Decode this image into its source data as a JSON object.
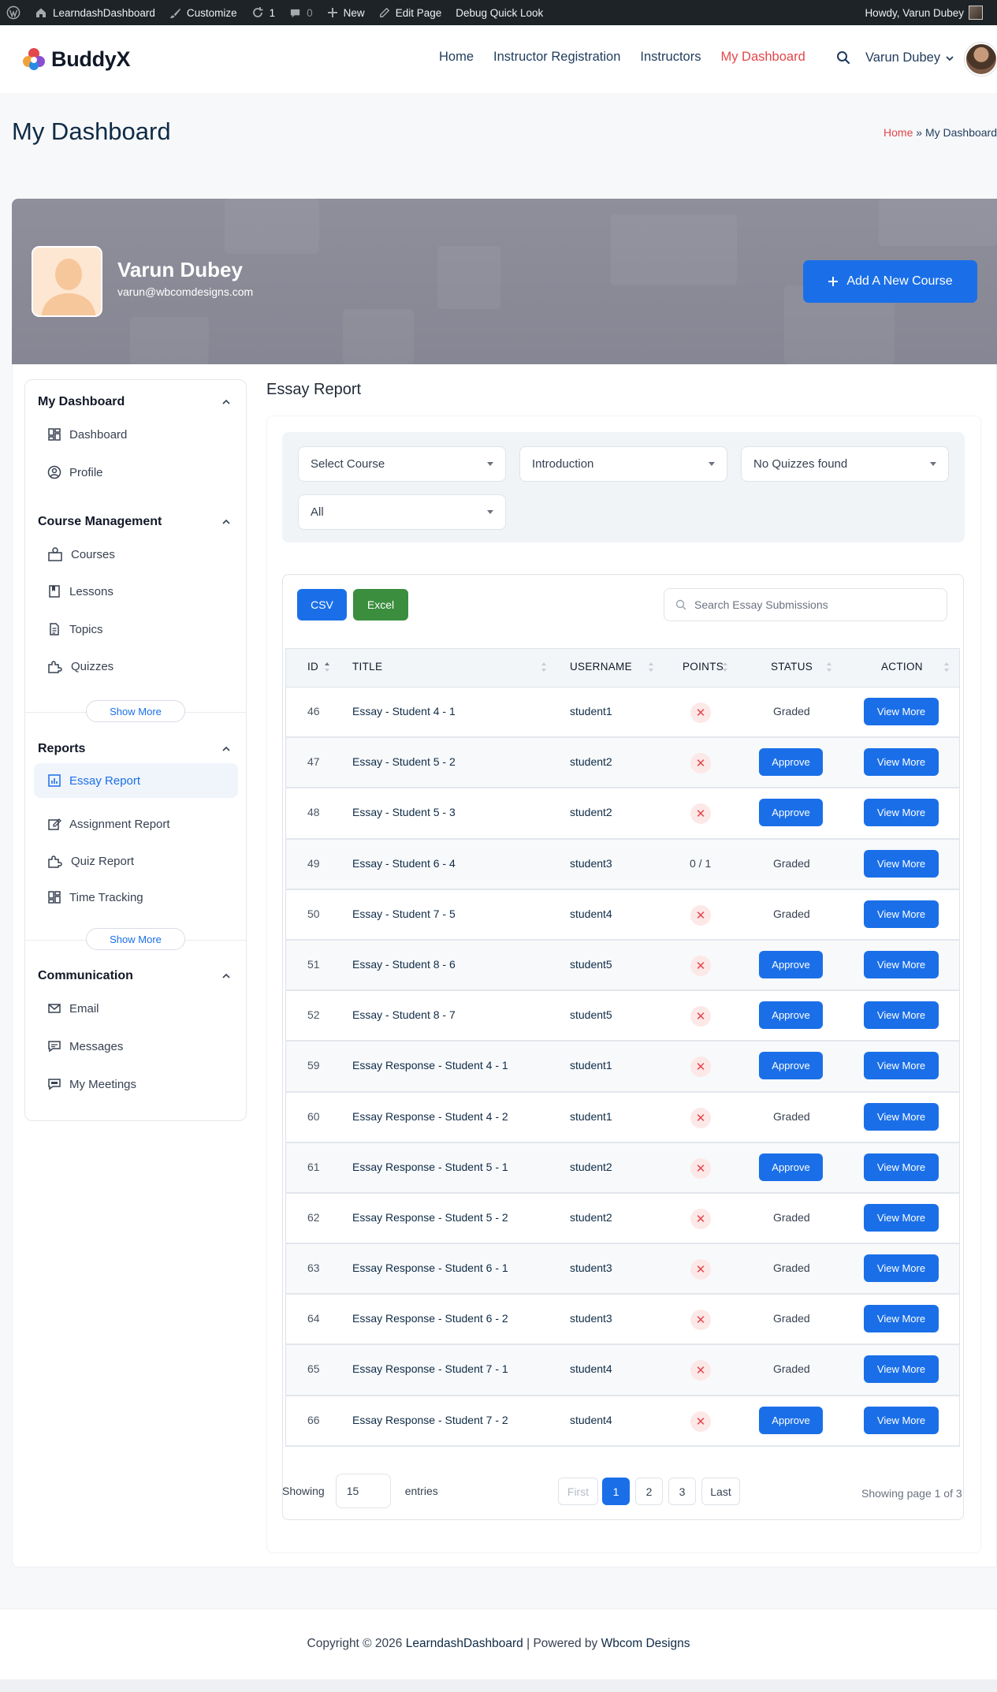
{
  "admin_bar": {
    "site_name": "LearndashDashboard",
    "customize": "Customize",
    "updates": "1",
    "comments": "0",
    "new": "New",
    "edit_page": "Edit Page",
    "debug": "Debug Quick Look",
    "howdy": "Howdy, Varun Dubey"
  },
  "header": {
    "logo": "BuddyX",
    "nav": [
      "Home",
      "Instructor Registration",
      "Instructors",
      "My Dashboard"
    ],
    "active_nav": "My Dashboard",
    "user": "Varun Dubey"
  },
  "page": {
    "title": "My Dashboard",
    "breadcrumb_home": "Home",
    "breadcrumb_sep": "»",
    "breadcrumb_current": "My Dashboard"
  },
  "profile": {
    "name": "Varun Dubey",
    "email": "varun@wbcomdesigns.com",
    "add_course": "Add A New Course"
  },
  "sidebar": {
    "sections": [
      {
        "title": "My Dashboard",
        "items": [
          "Dashboard",
          "Profile"
        ]
      },
      {
        "title": "Course Management",
        "items": [
          "Courses",
          "Lessons",
          "Topics",
          "Quizzes"
        ],
        "more": "Show More"
      },
      {
        "title": "Reports",
        "items": [
          "Essay Report",
          "Assignment Report",
          "Quiz Report",
          "Time Tracking"
        ],
        "more": "Show More",
        "active": "Essay Report"
      },
      {
        "title": "Communication",
        "items": [
          "Email",
          "Messages",
          "My Meetings"
        ]
      }
    ]
  },
  "report": {
    "title": "Essay Report",
    "filters": [
      "Select Course",
      "Introduction",
      "No Quizzes found",
      "All"
    ],
    "csv": "CSV",
    "excel": "Excel",
    "search_placeholder": "Search Essay Submissions",
    "columns": [
      "ID",
      "TITLE",
      "USERNAME",
      "POINTS",
      "STATUS",
      "ACTION"
    ],
    "rows": [
      {
        "id": "46",
        "title": "Essay - Student 4 - 1",
        "user": "student1",
        "points": "x",
        "status": "Graded"
      },
      {
        "id": "47",
        "title": "Essay - Student 5 - 2",
        "user": "student2",
        "points": "x",
        "status": "Approve"
      },
      {
        "id": "48",
        "title": "Essay - Student 5 - 3",
        "user": "student2",
        "points": "x",
        "status": "Approve"
      },
      {
        "id": "49",
        "title": "Essay - Student 6 - 4",
        "user": "student3",
        "points": "0 / 1",
        "status": "Graded"
      },
      {
        "id": "50",
        "title": "Essay - Student 7 - 5",
        "user": "student4",
        "points": "x",
        "status": "Graded"
      },
      {
        "id": "51",
        "title": "Essay - Student 8 - 6",
        "user": "student5",
        "points": "x",
        "status": "Approve"
      },
      {
        "id": "52",
        "title": "Essay - Student 8 - 7",
        "user": "student5",
        "points": "x",
        "status": "Approve"
      },
      {
        "id": "59",
        "title": "Essay Response - Student 4 - 1",
        "user": "student1",
        "points": "x",
        "status": "Approve"
      },
      {
        "id": "60",
        "title": "Essay Response - Student 4 - 2",
        "user": "student1",
        "points": "x",
        "status": "Graded"
      },
      {
        "id": "61",
        "title": "Essay Response - Student 5 - 1",
        "user": "student2",
        "points": "x",
        "status": "Approve"
      },
      {
        "id": "62",
        "title": "Essay Response - Student 5 - 2",
        "user": "student2",
        "points": "x",
        "status": "Graded"
      },
      {
        "id": "63",
        "title": "Essay Response - Student 6 - 1",
        "user": "student3",
        "points": "x",
        "status": "Graded"
      },
      {
        "id": "64",
        "title": "Essay Response - Student 6 - 2",
        "user": "student3",
        "points": "x",
        "status": "Graded"
      },
      {
        "id": "65",
        "title": "Essay Response - Student 7 - 1",
        "user": "student4",
        "points": "x",
        "status": "Graded"
      },
      {
        "id": "66",
        "title": "Essay Response - Student 7 - 2",
        "user": "student4",
        "points": "x",
        "status": "Approve"
      }
    ],
    "view_more": "View More",
    "approve": "Approve",
    "pager": {
      "showing": "Showing",
      "page_size": "15",
      "entries": "entries",
      "first": "First",
      "pages": [
        "1",
        "2",
        "3"
      ],
      "current": "1",
      "last": "Last",
      "info": "Showing page 1 of 3"
    }
  },
  "footer": {
    "prefix": "Copyright © 2026",
    "site": "LearndashDashboard",
    "mid": "| Powered by",
    "company": "Wbcom Designs"
  },
  "colors": {
    "accent": "#1a6fe8",
    "active_nav": "#e2474b",
    "excel": "#3a8e3e"
  }
}
